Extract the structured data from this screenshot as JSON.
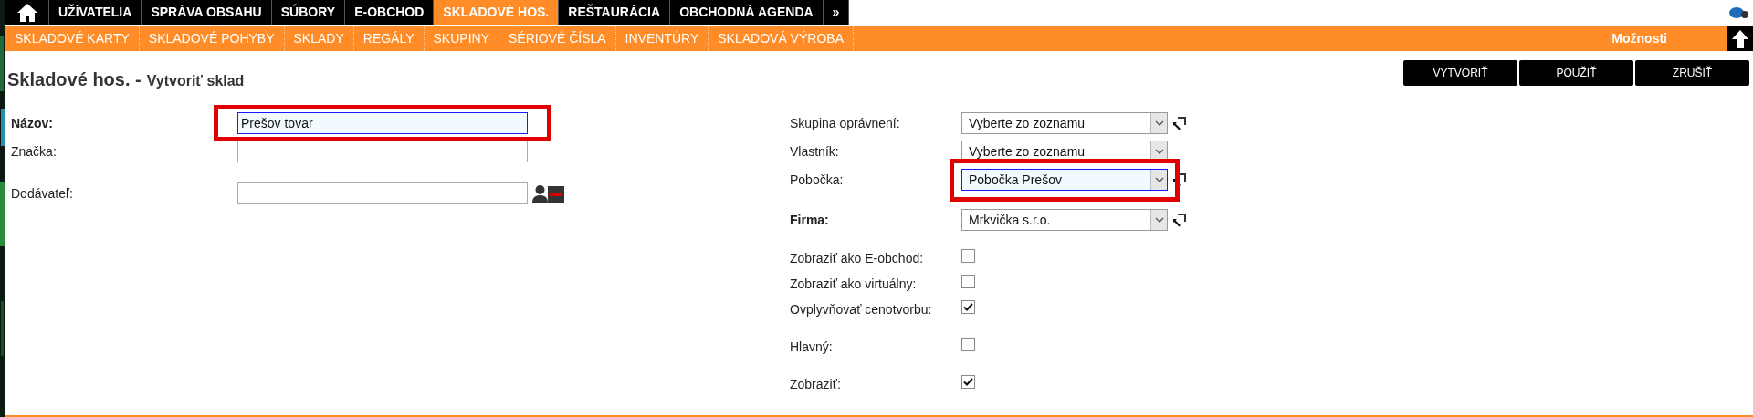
{
  "top_menu": [
    {
      "label": "UŽÍVATELIA",
      "selected": false
    },
    {
      "label": "SPRÁVA OBSAHU",
      "selected": false
    },
    {
      "label": "SÚBORY",
      "selected": false
    },
    {
      "label": "E-OBCHOD",
      "selected": false
    },
    {
      "label": "SKLADOVÉ HOS.",
      "selected": true
    },
    {
      "label": "REŠTAURÁCIA",
      "selected": false
    },
    {
      "label": "OBCHODNÁ AGENDA",
      "selected": false
    },
    {
      "label": "»",
      "selected": false
    }
  ],
  "sub_menu": [
    "SKLADOVÉ KARTY",
    "SKLADOVÉ POHYBY",
    "SKLADY",
    "REGÁLY",
    "SKUPINY",
    "SÉRIOVÉ ČÍSLA",
    "INVENTÚRY",
    "SKLADOVÁ VÝROBA"
  ],
  "options_label": "Možnosti",
  "page_title": {
    "section": "Skladové hos. -",
    "action": "Vytvoriť sklad"
  },
  "buttons": [
    "VYTVORIŤ",
    "POUŽIŤ",
    "ZRUŠIŤ"
  ],
  "left_groups": [
    [
      {
        "kind": "text",
        "label": "Názov:",
        "bold": true,
        "value": "Prešov tovar",
        "focused": true,
        "highlighted": true,
        "supplier_icons": false
      },
      {
        "kind": "text",
        "label": "Značka:",
        "bold": false,
        "focused": false,
        "highlighted": false,
        "supplier_icons": false
      }
    ],
    [
      {
        "kind": "text",
        "label": "Dodávateľ:",
        "bold": false,
        "focused": false,
        "highlighted": false,
        "supplier_icons": true
      }
    ]
  ],
  "right_groups": [
    [
      {
        "kind": "select",
        "label": "Skupina oprávnení:",
        "bold": false,
        "value": "Vyberte zo zoznamu",
        "focused": false,
        "highlighted": false,
        "link_icon": true
      },
      {
        "kind": "select",
        "label": "Vlastník:",
        "bold": false,
        "value": "Vyberte zo zoznamu",
        "focused": false,
        "highlighted": false,
        "link_icon": false
      },
      {
        "kind": "select",
        "label": "Pobočka:",
        "bold": false,
        "value": "Pobočka Prešov",
        "focused": true,
        "highlighted": true,
        "link_icon": true
      }
    ],
    [
      {
        "kind": "select",
        "label": "Firma:",
        "bold": true,
        "value": "Mrkvička s.r.o.",
        "focused": false,
        "highlighted": false,
        "link_icon": true
      }
    ],
    [
      {
        "kind": "checkbox",
        "label": "Zobraziť ako E-obchod:",
        "bold": false,
        "checked": false
      },
      {
        "kind": "checkbox",
        "label": "Zobraziť ako virtuálny:",
        "bold": false,
        "checked": false
      },
      {
        "kind": "checkbox",
        "label": "Ovplyvňovať cenotvorbu:",
        "bold": false,
        "checked": true
      }
    ],
    [
      {
        "kind": "checkbox",
        "label": "Hlavný:",
        "bold": false,
        "checked": false
      }
    ],
    [
      {
        "kind": "checkbox",
        "label": "Zobraziť:",
        "bold": false,
        "checked": true
      }
    ]
  ]
}
